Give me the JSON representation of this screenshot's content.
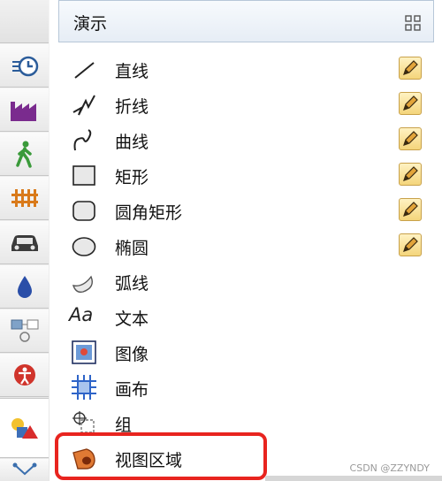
{
  "palette": {
    "title": "演示",
    "items": [
      {
        "label": "直线",
        "icon": "line-icon",
        "editable": true
      },
      {
        "label": "折线",
        "icon": "polyline-icon",
        "editable": true
      },
      {
        "label": "曲线",
        "icon": "curve-icon",
        "editable": true
      },
      {
        "label": "矩形",
        "icon": "rectangle-icon",
        "editable": true
      },
      {
        "label": "圆角矩形",
        "icon": "rounded-rectangle-icon",
        "editable": true
      },
      {
        "label": "椭圆",
        "icon": "ellipse-icon",
        "editable": true
      },
      {
        "label": "弧线",
        "icon": "arc-icon",
        "editable": false
      },
      {
        "label": "文本",
        "icon": "text-icon",
        "icon_text": "Aa",
        "editable": false
      },
      {
        "label": "图像",
        "icon": "image-icon",
        "editable": false
      },
      {
        "label": "画布",
        "icon": "canvas-icon",
        "editable": false
      },
      {
        "label": "组",
        "icon": "group-icon",
        "editable": false
      },
      {
        "label": "视图区域",
        "icon": "view-area-icon",
        "editable": false
      }
    ]
  },
  "side_tabs": [
    {
      "icon": "blank-tab"
    },
    {
      "icon": "timer-icon"
    },
    {
      "icon": "factory-icon"
    },
    {
      "icon": "pedestrian-icon"
    },
    {
      "icon": "railway-icon"
    },
    {
      "icon": "car-icon"
    },
    {
      "icon": "fluid-drop-icon"
    },
    {
      "icon": "process-flow-icon"
    },
    {
      "icon": "accessibility-icon"
    },
    {
      "icon": "presentation-shapes-icon",
      "active": true
    },
    {
      "icon": "network-icon"
    }
  ],
  "colors": {
    "highlight": "#e8241f",
    "header_border": "#b7c7d8",
    "edit_button": "#f4d57b"
  },
  "watermark": "CSDN @ZZYNDY"
}
